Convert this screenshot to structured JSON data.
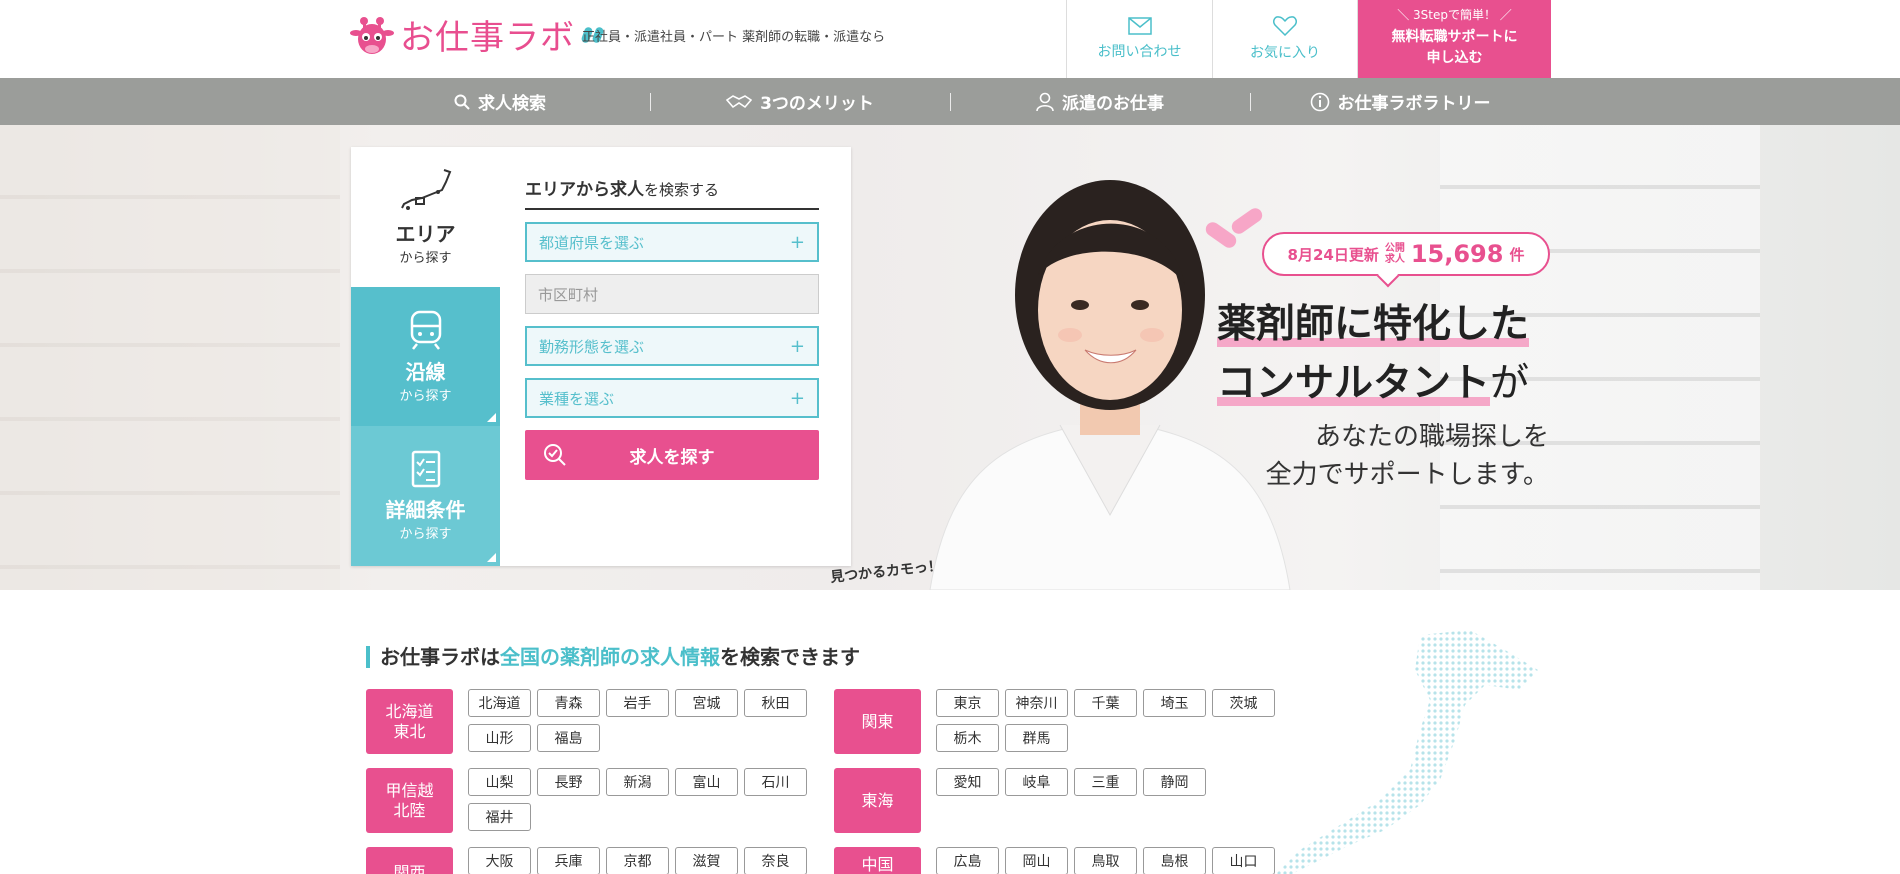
{
  "header": {
    "tagline": "正社員・派遣社員・パート 薬剤師の転職・派遣なら",
    "logo_text": "お仕事ラボ",
    "contact_label": "お問い合わせ",
    "favorite_label": "お気に入り",
    "cta_small": "＼ 3Stepで簡単！ ／",
    "cta_line1": "無料転職サポートに",
    "cta_line2": "申し込む",
    "brand_color": "#e8508f",
    "accent_color": "#4bbfca"
  },
  "nav": {
    "items": [
      {
        "label": "求人検索",
        "icon": "search-icon"
      },
      {
        "label": "3つのメリット",
        "icon": "handshake-icon"
      },
      {
        "label": "派遣のお仕事",
        "icon": "person-icon"
      },
      {
        "label": "お仕事ラボラトリー",
        "icon": "info-icon"
      }
    ]
  },
  "search": {
    "tabs": [
      {
        "title": "エリア",
        "sub": "から探す",
        "icon": "map-icon"
      },
      {
        "title": "沿線",
        "sub": "から探す",
        "icon": "train-icon"
      },
      {
        "title": "詳細条件",
        "sub": "から探す",
        "icon": "checklist-icon"
      }
    ],
    "form_title_bold": "エリアから求人",
    "form_title_rest": "を検索する",
    "prefecture_select": "都道府県を選ぶ",
    "city_placeholder": "市区町村",
    "employment_select": "勤務形態を選ぶ",
    "job_type_select": "業種を選ぶ",
    "submit_label": "求人を探す"
  },
  "hero": {
    "mascot_caption": "見つかるカモっ！",
    "update_date": "8月24日更新",
    "public_label_1": "公開",
    "public_label_2": "求人",
    "job_count": "15,698",
    "count_unit": "件",
    "headline_1": "薬剤師に特化した",
    "headline_2": "コンサルタント",
    "headline_2_suffix": "が",
    "sub_1": "あなたの職場探しを",
    "sub_2": "全力でサポートします。"
  },
  "regions_section": {
    "title_pre": "お仕事ラボは",
    "title_em": "全国の薬剤師の求人情報",
    "title_post": "を検索できます",
    "left": [
      {
        "name_1": "北海道",
        "name_2": "東北",
        "prefs": [
          "北海道",
          "青森",
          "岩手",
          "宮城",
          "秋田",
          "山形",
          "福島"
        ]
      },
      {
        "name_1": "甲信越",
        "name_2": "北陸",
        "prefs": [
          "山梨",
          "長野",
          "新潟",
          "富山",
          "石川",
          "福井"
        ]
      },
      {
        "name_1": "関西",
        "name_2": "",
        "prefs": [
          "大阪",
          "兵庫",
          "京都",
          "滋賀",
          "奈良"
        ]
      }
    ],
    "right": [
      {
        "name_1": "関東",
        "name_2": "",
        "prefs": [
          "東京",
          "神奈川",
          "千葉",
          "埼玉",
          "茨城",
          "栃木",
          "群馬"
        ]
      },
      {
        "name_1": "東海",
        "name_2": "",
        "prefs": [
          "愛知",
          "岐阜",
          "三重",
          "静岡"
        ]
      },
      {
        "name_1": "中国",
        "name_2": "",
        "prefs": [
          "広島",
          "岡山",
          "鳥取",
          "島根",
          "山口"
        ]
      }
    ]
  }
}
